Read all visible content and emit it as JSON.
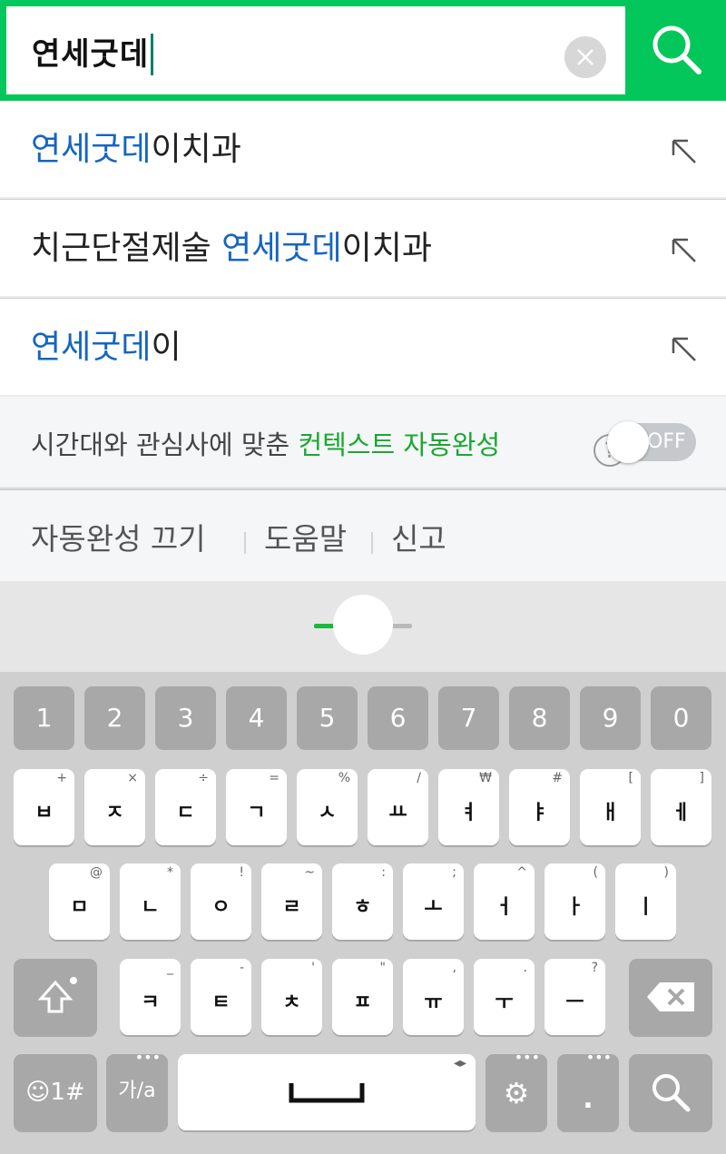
{
  "search": {
    "query": "연세굿데",
    "clear_icon": "close-icon",
    "search_icon": "search-icon"
  },
  "suggestions": [
    {
      "pre": "",
      "hl": "연세굿데",
      "post": "이치과"
    },
    {
      "pre": "치근단절제술 ",
      "hl": "연세굿데",
      "post": "이치과"
    },
    {
      "pre": "",
      "hl": "연세굿데",
      "post": "이"
    }
  ],
  "context": {
    "text": "시간대와 관심사에 맞춘 ",
    "highlight": "컨텍스트 자동완성",
    "help": "?",
    "toggle_label": "OFF"
  },
  "footer": {
    "autocomplete_off": "자동완성 끄기",
    "help": "도움말",
    "report": "신고"
  },
  "colors": {
    "brand": "#03c75a",
    "highlight": "#1565c0",
    "context_green": "#19a832"
  },
  "keyboard": {
    "numbers": [
      "1",
      "2",
      "3",
      "4",
      "5",
      "6",
      "7",
      "8",
      "9",
      "0"
    ],
    "row1": [
      {
        "k": "ㅂ",
        "s": "+"
      },
      {
        "k": "ㅈ",
        "s": "×"
      },
      {
        "k": "ㄷ",
        "s": "÷"
      },
      {
        "k": "ㄱ",
        "s": "="
      },
      {
        "k": "ㅅ",
        "s": "%"
      },
      {
        "k": "ㅛ",
        "s": "/"
      },
      {
        "k": "ㅕ",
        "s": "₩"
      },
      {
        "k": "ㅑ",
        "s": "#"
      },
      {
        "k": "ㅐ",
        "s": "["
      },
      {
        "k": "ㅔ",
        "s": "]"
      }
    ],
    "row2": [
      {
        "k": "ㅁ",
        "s": "@"
      },
      {
        "k": "ㄴ",
        "s": "*"
      },
      {
        "k": "ㅇ",
        "s": "!"
      },
      {
        "k": "ㄹ",
        "s": "~"
      },
      {
        "k": "ㅎ",
        "s": ":"
      },
      {
        "k": "ㅗ",
        "s": ";"
      },
      {
        "k": "ㅓ",
        "s": "^"
      },
      {
        "k": "ㅏ",
        "s": "("
      },
      {
        "k": "ㅣ",
        "s": ")"
      }
    ],
    "row3": [
      {
        "k": "ㅋ",
        "s": "_"
      },
      {
        "k": "ㅌ",
        "s": "-"
      },
      {
        "k": "ㅊ",
        "s": "'"
      },
      {
        "k": "ㅍ",
        "s": "\""
      },
      {
        "k": "ㅠ",
        "s": ","
      },
      {
        "k": "ㅜ",
        "s": "."
      },
      {
        "k": "ㅡ",
        "s": "?"
      }
    ],
    "symbols_label": "☺1#",
    "lang_label": "가/a",
    "period": "."
  }
}
